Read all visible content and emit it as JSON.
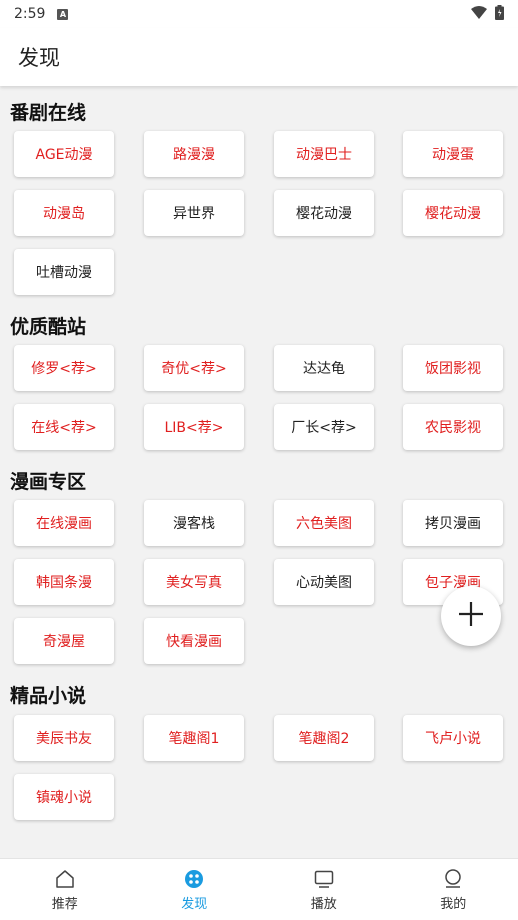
{
  "status_bar": {
    "time": "2:59",
    "notification_letter": "A"
  },
  "app_bar": {
    "title": "发现"
  },
  "colors": {
    "red": "#e02020",
    "black": "#222222",
    "accent": "#1a9be0"
  },
  "sections": [
    {
      "title": "番剧在线",
      "items": [
        {
          "label": "AGE动漫",
          "color": "red"
        },
        {
          "label": "路漫漫",
          "color": "red"
        },
        {
          "label": "动漫巴士",
          "color": "red"
        },
        {
          "label": "动漫蛋",
          "color": "red"
        },
        {
          "label": "动漫岛",
          "color": "red"
        },
        {
          "label": "异世界",
          "color": "black"
        },
        {
          "label": "樱花动漫",
          "color": "black"
        },
        {
          "label": "樱花动漫",
          "color": "red"
        },
        {
          "label": "吐槽动漫",
          "color": "black"
        }
      ]
    },
    {
      "title": "优质酷站",
      "items": [
        {
          "label": "修罗<荐>",
          "color": "red"
        },
        {
          "label": "奇优<荐>",
          "color": "red"
        },
        {
          "label": "达达龟",
          "color": "black"
        },
        {
          "label": "饭团影视",
          "color": "red"
        },
        {
          "label": "在线<荐>",
          "color": "red"
        },
        {
          "label": "LIB<荐>",
          "color": "red"
        },
        {
          "label": "厂长<荐>",
          "color": "black"
        },
        {
          "label": "农民影视",
          "color": "red"
        }
      ]
    },
    {
      "title": "漫画专区",
      "items": [
        {
          "label": "在线漫画",
          "color": "red"
        },
        {
          "label": "漫客栈",
          "color": "black"
        },
        {
          "label": "六色美图",
          "color": "red"
        },
        {
          "label": "拷贝漫画",
          "color": "black"
        },
        {
          "label": "韩国条漫",
          "color": "red"
        },
        {
          "label": "美女写真",
          "color": "red"
        },
        {
          "label": "心动美图",
          "color": "black"
        },
        {
          "label": "包子漫画",
          "color": "red"
        },
        {
          "label": "奇漫屋",
          "color": "red"
        },
        {
          "label": "快看漫画",
          "color": "red"
        }
      ]
    },
    {
      "title": "精品小说",
      "items": [
        {
          "label": "美辰书友",
          "color": "red"
        },
        {
          "label": "笔趣阁1",
          "color": "red"
        },
        {
          "label": "笔趣阁2",
          "color": "red"
        },
        {
          "label": "飞卢小说",
          "color": "red"
        },
        {
          "label": "镇魂小说",
          "color": "red"
        }
      ]
    }
  ],
  "bottom_nav": [
    {
      "label": "推荐",
      "icon": "home-icon",
      "active": false
    },
    {
      "label": "发现",
      "icon": "discover-icon",
      "active": true
    },
    {
      "label": "播放",
      "icon": "tv-icon",
      "active": false
    },
    {
      "label": "我的",
      "icon": "profile-icon",
      "active": false
    }
  ]
}
